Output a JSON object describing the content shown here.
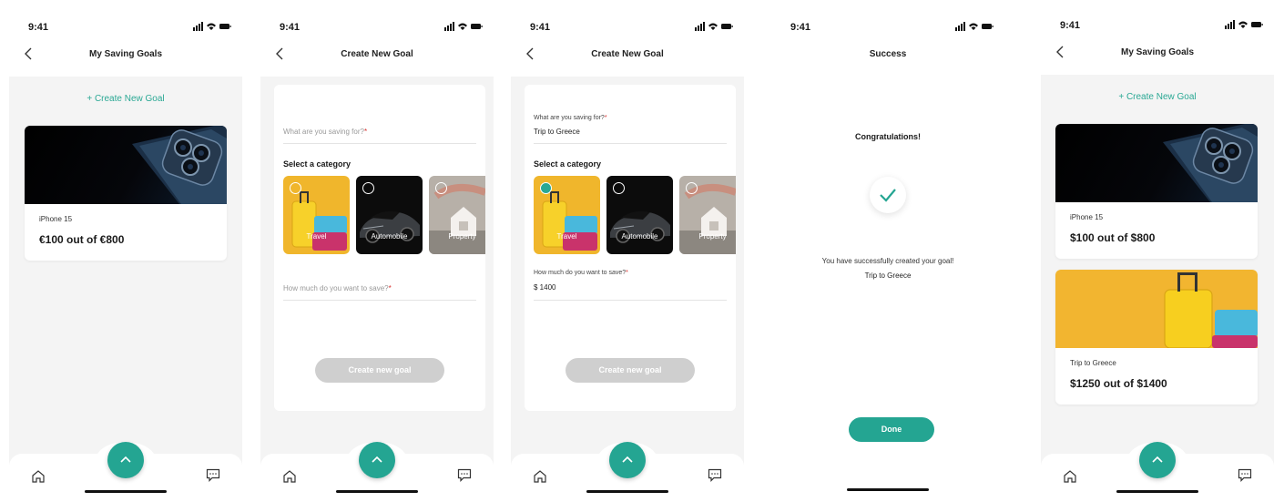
{
  "status": {
    "time": "9:41"
  },
  "screens": {
    "my_goals_1": {
      "title": "My Saving Goals",
      "create_link": "+ Create New Goal",
      "goals": [
        {
          "name": "iPhone 15",
          "progress": "€100 out of €800",
          "image": "iphone-photo"
        }
      ]
    },
    "create_empty": {
      "title": "Create New Goal",
      "saving_for_label": "What are you saving for?",
      "required_mark": "*",
      "category_title": "Select a category",
      "categories": [
        {
          "label": "Travel",
          "image": "suitcase-photo",
          "selected": false
        },
        {
          "label": "Automobile",
          "image": "car-photo",
          "selected": false
        },
        {
          "label": "Property",
          "image": "house-photo",
          "selected": false
        }
      ],
      "amount_label": "How much do you want to save?",
      "button": "Create new goal"
    },
    "create_filled": {
      "title": "Create New Goal",
      "saving_for_label": "What are you saving for?",
      "saving_for_value": "Trip to Greece",
      "required_mark": "*",
      "category_title": "Select a category",
      "categories": [
        {
          "label": "Travel",
          "image": "suitcase-photo",
          "selected": true
        },
        {
          "label": "Automobile",
          "image": "car-photo",
          "selected": false
        },
        {
          "label": "Property",
          "image": "house-photo",
          "selected": false
        }
      ],
      "amount_label": "How much do you want to save?",
      "amount_value": "$ 1400",
      "button": "Create new goal"
    },
    "success": {
      "title": "Success",
      "heading": "Congratulations!",
      "message": "You have successfully created your goal!",
      "goal_name": "Trip to Greece",
      "button": "Done"
    },
    "my_goals_2": {
      "title": "My Saving Goals",
      "create_link": "+ Create New Goal",
      "goals": [
        {
          "name": "iPhone 15",
          "progress": "$100 out of $800",
          "image": "iphone-photo"
        },
        {
          "name": "Trip to Greece",
          "progress": "$1250 out of $1400",
          "image": "suitcase-photo"
        }
      ]
    }
  },
  "nav": {
    "home": "home-icon",
    "fab": "chevron-up-icon",
    "chat": "chat-icon"
  },
  "colors": {
    "accent": "#24a592",
    "link": "#2aa894",
    "required": "#d9302e",
    "disabled": "#cfcfcf"
  }
}
